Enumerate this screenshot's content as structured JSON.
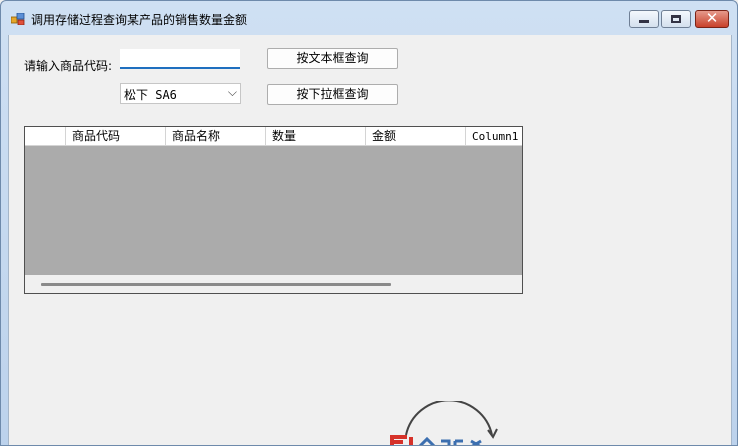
{
  "window": {
    "title": "调用存储过程查询某产品的销售数量金额",
    "controls": {
      "minimize": "",
      "maximize": "",
      "close": "✕"
    }
  },
  "form": {
    "input_label": "请输入商品代码:",
    "text_input_value": "",
    "combo_selected": "松下 SA6",
    "combo_arrow": "⌵",
    "text_query_button": "按文本框查询",
    "combo_query_button": "按下拉框查询"
  },
  "grid": {
    "columns": [
      "",
      "商品代码",
      "商品名称",
      "数量",
      "金额",
      "Column1"
    ],
    "rows": []
  },
  "colors": {
    "title_bar": "#c4d8ef",
    "client_background": "#f0f0f0",
    "grid_empty_background": "#ababab",
    "textbox_focus_underline": "#1f6fbf",
    "close_button": "#c8412b"
  }
}
